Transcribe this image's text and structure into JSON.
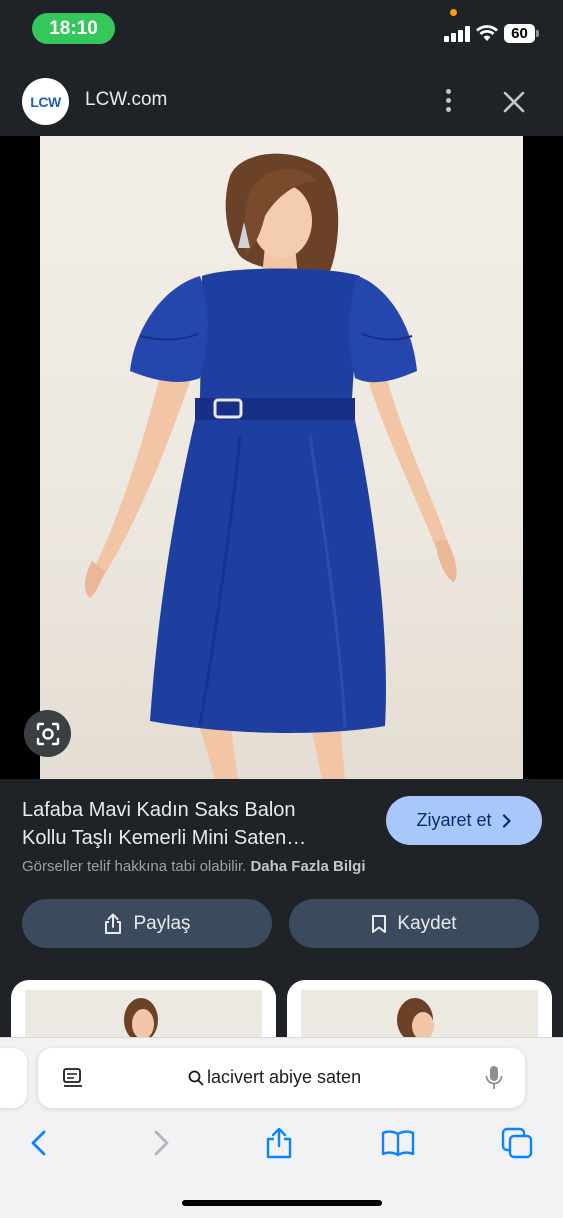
{
  "status_bar": {
    "time": "18:10",
    "battery": "60"
  },
  "header": {
    "site_logo_text": "LCW",
    "site_name": "LCW.com"
  },
  "product": {
    "title_line1": "Lafaba Mavi Kadın Saks Balon",
    "title_line2": "Kollu Taşlı Kemerli Mini Saten…",
    "visit_label": "Ziyaret et",
    "copyright_text": "Görseller telif hakkına tabi olabilir.",
    "more_info_label": "Daha Fazla Bilgi",
    "share_label": "Paylaş",
    "save_label": "Kaydet"
  },
  "address_bar": {
    "query": "lacivert abiye saten"
  },
  "colors": {
    "accent": "#a8c7fa",
    "dress": "#1f3fa0",
    "ios_blue": "#0a84ff",
    "status_green": "#34c759"
  }
}
